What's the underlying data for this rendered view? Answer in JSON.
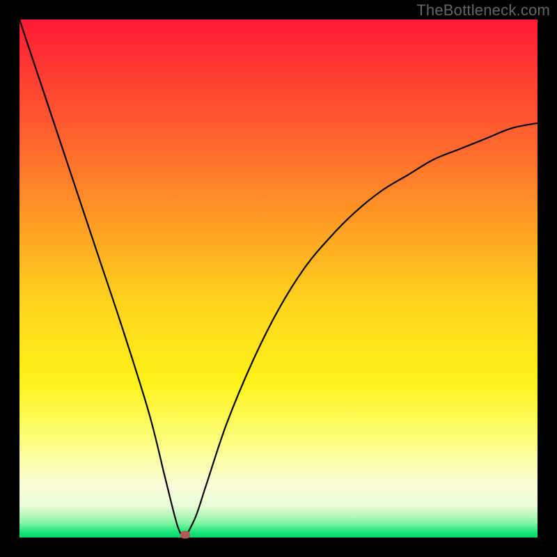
{
  "watermark": "TheBottleneck.com",
  "chart_data": {
    "type": "line",
    "title": "",
    "xlabel": "",
    "ylabel": "",
    "xlim": [
      0,
      100
    ],
    "ylim": [
      0,
      100
    ],
    "grid": false,
    "legend": false,
    "series": [
      {
        "name": "left-curve",
        "x": [
          0,
          5,
          10,
          15,
          20,
          25,
          28,
          30,
          31,
          32
        ],
        "values": [
          100,
          85,
          70,
          55,
          40,
          24,
          12,
          4,
          1,
          0
        ]
      },
      {
        "name": "right-curve",
        "x": [
          32,
          34,
          36,
          40,
          45,
          50,
          55,
          60,
          65,
          70,
          75,
          80,
          85,
          90,
          95,
          100
        ],
        "values": [
          0,
          4,
          10,
          22,
          34,
          44,
          52,
          58,
          63,
          67,
          70,
          73,
          75,
          77,
          79,
          80
        ]
      }
    ],
    "marker": {
      "x": 32,
      "y": 0,
      "color": "#b55a52"
    },
    "gradient_stops": [
      {
        "pos": 0,
        "color": "#ff1a35"
      },
      {
        "pos": 25,
        "color": "#ff6a2e"
      },
      {
        "pos": 55,
        "color": "#ffd41c"
      },
      {
        "pos": 80,
        "color": "#fdfd70"
      },
      {
        "pos": 94,
        "color": "#e8fcd8"
      },
      {
        "pos": 100,
        "color": "#04d46a"
      }
    ]
  }
}
